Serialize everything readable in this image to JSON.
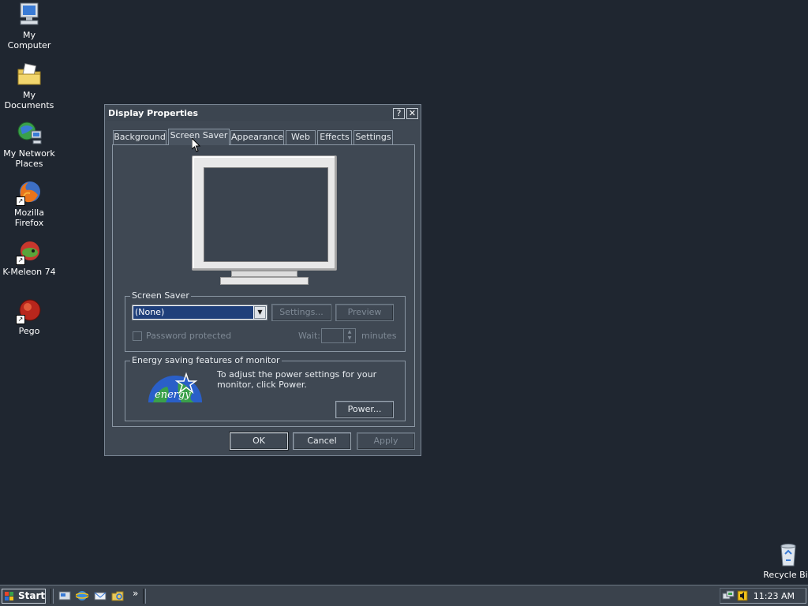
{
  "desktop": {
    "icons": [
      {
        "label": "My Computer"
      },
      {
        "label": "My Documents"
      },
      {
        "label": "My Network Places"
      },
      {
        "label": "Mozilla Firefox"
      },
      {
        "label": "K-Meleon 74"
      },
      {
        "label": "Pego"
      },
      {
        "label": "Recycle Bin"
      }
    ]
  },
  "dialog": {
    "title": "Display Properties",
    "help_button": "?",
    "close_button": "✕",
    "tabs": [
      {
        "label": "Background"
      },
      {
        "label": "Screen Saver",
        "active": true
      },
      {
        "label": "Appearance"
      },
      {
        "label": "Web"
      },
      {
        "label": "Effects"
      },
      {
        "label": "Settings"
      }
    ],
    "screensaver": {
      "group_label": "Screen Saver",
      "selected": "(None)",
      "settings_label": "Settings...",
      "preview_label": "Preview",
      "password_label": "Password protected",
      "wait_label": "Wait:",
      "minutes_label": "minutes",
      "wait_value": "",
      "password_checked": false
    },
    "energy": {
      "group_label": "Energy saving features of monitor",
      "text": "To adjust the power settings for your monitor, click Power.",
      "power_label": "Power...",
      "logo_text": "energy"
    },
    "buttons": {
      "ok": "OK",
      "cancel": "Cancel",
      "apply": "Apply"
    }
  },
  "taskbar": {
    "start_label": "Start",
    "chevron": "»",
    "clock": "11:23 AM"
  },
  "colors": {
    "desktop": "#1f2630",
    "dialog": "#3f4853",
    "selection": "#1f3f7a"
  }
}
